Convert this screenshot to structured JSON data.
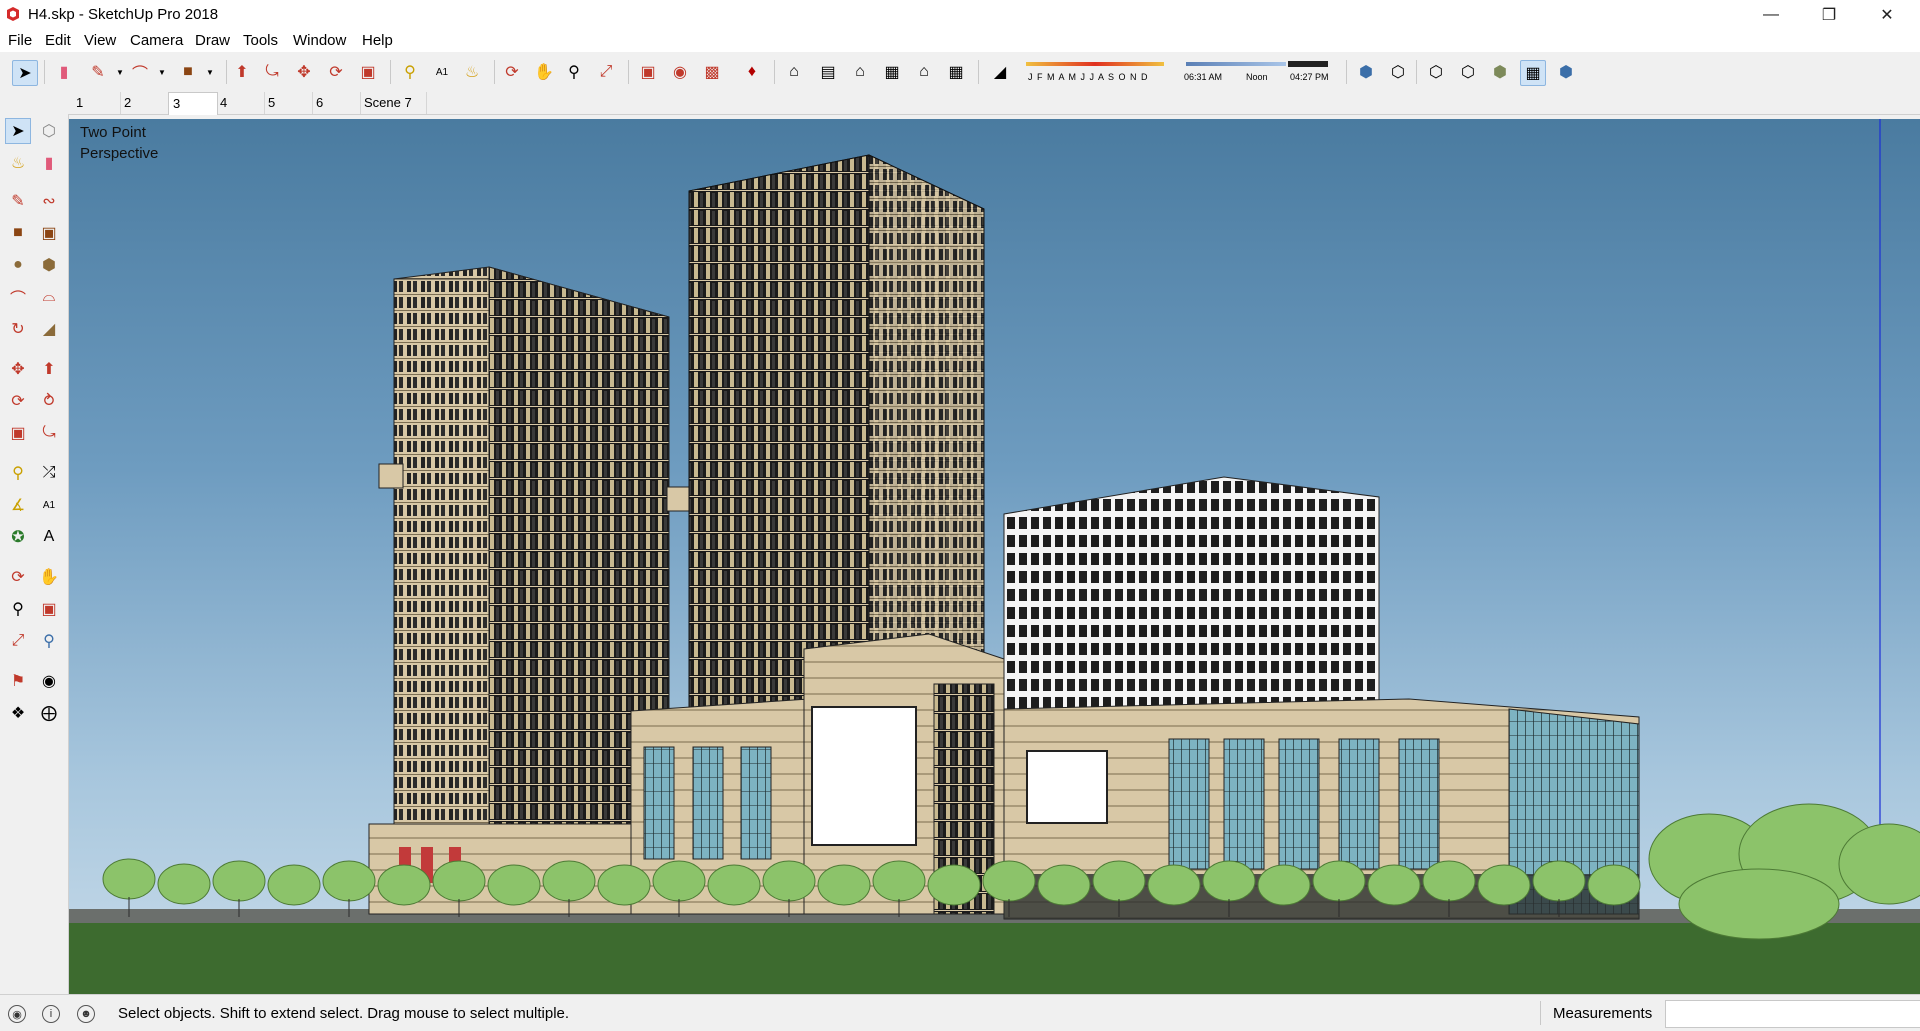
{
  "window": {
    "title": "H4.skp - SketchUp Pro 2018",
    "controls": [
      "minimize",
      "maximize",
      "close"
    ]
  },
  "menu": [
    "File",
    "Edit",
    "View",
    "Camera",
    "Draw",
    "Tools",
    "Window",
    "Help"
  ],
  "shadow_settings": {
    "months": "J F M A M J J A S O N D",
    "time_start": "06:31 AM",
    "time_mid": "Noon",
    "time_end": "04:27 PM"
  },
  "scene_tabs": [
    "1",
    "2",
    "3",
    "4",
    "5",
    "6",
    "Scene 7"
  ],
  "selected_scene_tab": "3",
  "viewport": {
    "camera_label_line1": "Two Point",
    "camera_label_line2": "Perspective"
  },
  "status": {
    "hint": "Select objects. Shift to extend select. Drag mouse to select multiple.",
    "measurements_label": "Measurements",
    "measurements_value": ""
  },
  "colors": {
    "sky_top": "#4a7ba0",
    "sky_bottom": "#c9dcea",
    "facade_beige": "#d8c8a6",
    "glass_dark": "#1b1b1b",
    "lawn": "#3d6b2f",
    "tree": "#8cc36a",
    "selection_blue": "#cfe3f6"
  }
}
